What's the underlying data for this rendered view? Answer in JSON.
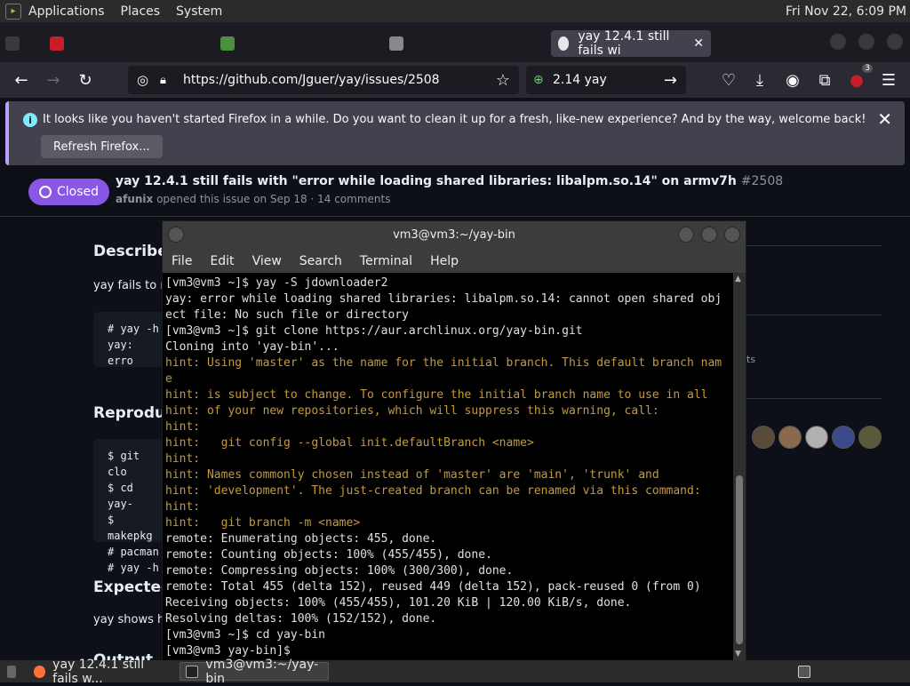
{
  "topbar": {
    "menus": [
      "Applications",
      "Places",
      "System"
    ],
    "clock": "Fri Nov 22,  6:09 PM"
  },
  "browser": {
    "active_tab_title": "yay 12.4.1 still fails wi",
    "url": "https://github.com/Jguer/yay/issues/2508",
    "search_query": "2.14 yay",
    "notification": {
      "message": "It looks like you haven't started Firefox in a while. Do you want to clean it up for a fresh, like-new experience? And by the way, welcome back!",
      "button": "Refresh Firefox...",
      "badge_count": "3"
    }
  },
  "issue": {
    "status": "Closed",
    "title": "yay 12.4.1 still fails with \"error while loading shared libraries: libalpm.so.14\" on armv7h",
    "number": "#2508",
    "author": "afunix",
    "meta": "opened this issue on Sep 18 · 14 comments",
    "sections": {
      "describe": "Describe",
      "describe_text": "yay fails to ru",
      "reproduce": "Reproduc",
      "expected": "Expected",
      "expected_text": "yay shows h",
      "output": "Output"
    },
    "code1": [
      "# yay -h",
      "yay: erro"
    ],
    "code2": [
      "$ git clo",
      "$ cd yay-",
      "$ makepkg",
      "# pacman",
      "# yay -h"
    ],
    "side_text": "ts"
  },
  "terminal": {
    "title": "vm3@vm3:~/yay-bin",
    "menu": [
      "File",
      "Edit",
      "View",
      "Search",
      "Terminal",
      "Help"
    ],
    "lines": [
      {
        "t": "[vm3@vm3 ~]$ yay -S jdownloader2",
        "h": false
      },
      {
        "t": "yay: error while loading shared libraries: libalpm.so.14: cannot open shared obj",
        "h": false
      },
      {
        "t": "ect file: No such file or directory",
        "h": false
      },
      {
        "t": "[vm3@vm3 ~]$ git clone https://aur.archlinux.org/yay-bin.git",
        "h": false
      },
      {
        "t": "Cloning into 'yay-bin'...",
        "h": false
      },
      {
        "t": "hint: Using 'master' as the name for the initial branch. This default branch nam",
        "h": true
      },
      {
        "t": "e",
        "h": true
      },
      {
        "t": "hint: is subject to change. To configure the initial branch name to use in all",
        "h": true
      },
      {
        "t": "hint: of your new repositories, which will suppress this warning, call:",
        "h": true
      },
      {
        "t": "hint:",
        "h": true
      },
      {
        "t": "hint:   git config --global init.defaultBranch <name>",
        "h": true
      },
      {
        "t": "hint:",
        "h": true
      },
      {
        "t": "hint: Names commonly chosen instead of 'master' are 'main', 'trunk' and",
        "h": true
      },
      {
        "t": "hint: 'development'. The just-created branch can be renamed via this command:",
        "h": true
      },
      {
        "t": "hint:",
        "h": true
      },
      {
        "t": "hint:   git branch -m <name>",
        "h": true
      },
      {
        "t": "remote: Enumerating objects: 455, done.",
        "h": false
      },
      {
        "t": "remote: Counting objects: 100% (455/455), done.",
        "h": false
      },
      {
        "t": "remote: Compressing objects: 100% (300/300), done.",
        "h": false
      },
      {
        "t": "remote: Total 455 (delta 152), reused 449 (delta 152), pack-reused 0 (from 0)",
        "h": false
      },
      {
        "t": "Receiving objects: 100% (455/455), 101.20 KiB | 120.00 KiB/s, done.",
        "h": false
      },
      {
        "t": "Resolving deltas: 100% (152/152), done.",
        "h": false
      },
      {
        "t": "[vm3@vm3 ~]$ cd yay-bin",
        "h": false
      },
      {
        "t": "[vm3@vm3 yay-bin]$",
        "h": false
      }
    ]
  },
  "taskbar": {
    "tasks": [
      "yay 12.4.1 still fails w...",
      "vm3@vm3:~/yay-bin"
    ]
  }
}
